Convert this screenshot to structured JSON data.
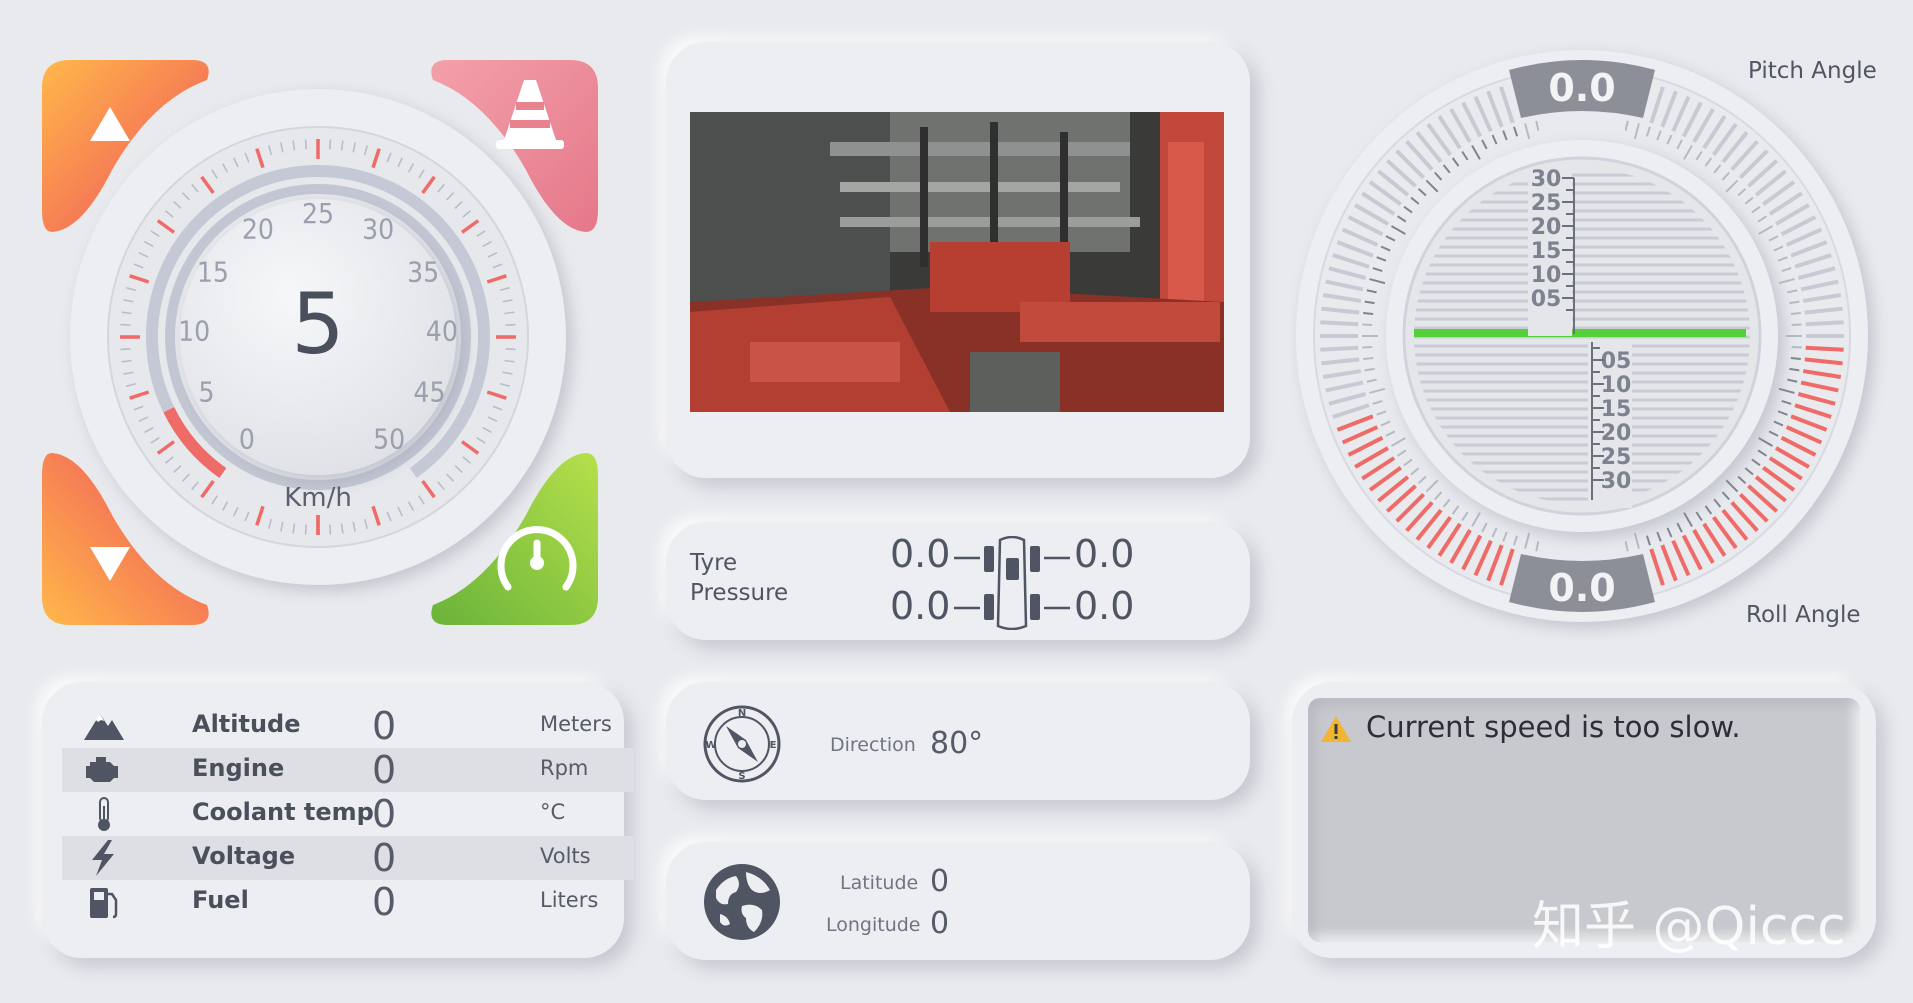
{
  "speedometer": {
    "value": "5",
    "unit": "Km/h",
    "ticks": [
      "0",
      "5",
      "10",
      "15",
      "20",
      "25",
      "30",
      "35",
      "40",
      "45",
      "50"
    ],
    "level_fraction": 0.1
  },
  "buttons": {
    "up_icon": "triangle-up-icon",
    "down_icon": "triangle-down-icon",
    "cone_icon": "traffic-cone-icon",
    "gauge_icon": "speed-gauge-icon"
  },
  "tyre_pressure": {
    "label_line1": "Tyre",
    "label_line2": "Pressure",
    "front_left": "0.0",
    "front_right": "0.0",
    "rear_left": "0.0",
    "rear_right": "0.0"
  },
  "attitude": {
    "pitch_label": "Pitch Angle",
    "roll_label": "Roll Angle",
    "pitch_value": "0.0",
    "roll_value": "0.0",
    "ladder_up": [
      "30",
      "25",
      "20",
      "15",
      "10",
      "05"
    ],
    "ladder_down": [
      "05",
      "10",
      "15",
      "20",
      "25",
      "30"
    ],
    "colors": {
      "warning": "#ef6b68",
      "level": "#55d03a",
      "dark": "#8c8f98"
    }
  },
  "info": {
    "rows": [
      {
        "icon": "mountain-icon",
        "name": "Altitude",
        "value": "0",
        "unit": "Meters"
      },
      {
        "icon": "engine-icon",
        "name": "Engine",
        "value": "0",
        "unit": "Rpm"
      },
      {
        "icon": "thermometer-icon",
        "name": "Coolant temp",
        "value": "0",
        "unit": "°C"
      },
      {
        "icon": "lightning-icon",
        "name": "Voltage",
        "value": "0",
        "unit": "Volts"
      },
      {
        "icon": "fuel-pump-icon",
        "name": "Fuel",
        "value": "0",
        "unit": "Liters"
      }
    ]
  },
  "direction": {
    "label": "Direction",
    "value": "80°",
    "compass_letters": [
      "N",
      "E",
      "S",
      "W"
    ]
  },
  "location": {
    "lat_label": "Latitude",
    "lat_value": "0",
    "lon_label": "Longitude",
    "lon_value": "0"
  },
  "alert": {
    "message": "Current speed is too slow.",
    "icon": "warning-icon"
  },
  "watermark": "知乎 @Qiccc",
  "camera": {
    "icon": "camera-feed"
  }
}
